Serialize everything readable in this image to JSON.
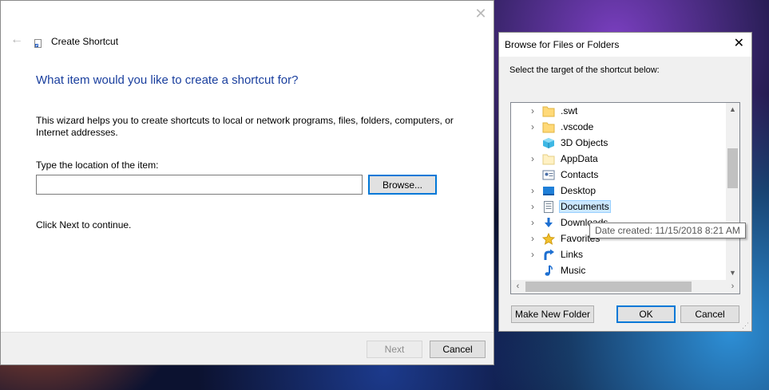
{
  "wizard": {
    "title": "Create Shortcut",
    "heading": "What item would you like to create a shortcut for?",
    "description": "This wizard helps you to create shortcuts to local or network programs, files, folders, computers, or Internet addresses.",
    "location_label": "Type the location of the item:",
    "location_value": "",
    "browse_label": "Browse...",
    "continue_text": "Click Next to continue.",
    "next_label": "Next",
    "cancel_label": "Cancel",
    "close_icon": "close-icon",
    "back_icon": "back-arrow-icon"
  },
  "browse": {
    "title": "Browse for Files or Folders",
    "prompt": "Select the target of the shortcut below:",
    "items": [
      {
        "label": ".swt",
        "icon": "folder-icon",
        "expandable": true
      },
      {
        "label": ".vscode",
        "icon": "folder-icon",
        "expandable": true
      },
      {
        "label": "3D Objects",
        "icon": "3d-objects-icon",
        "expandable": false
      },
      {
        "label": "AppData",
        "icon": "folder-icon",
        "expandable": true
      },
      {
        "label": "Contacts",
        "icon": "contacts-icon",
        "expandable": false
      },
      {
        "label": "Desktop",
        "icon": "desktop-icon",
        "expandable": true
      },
      {
        "label": "Documents",
        "icon": "documents-icon",
        "expandable": true,
        "selected": true
      },
      {
        "label": "Downloads",
        "icon": "downloads-icon",
        "expandable": true
      },
      {
        "label": "Favorites",
        "icon": "favorites-icon",
        "expandable": true
      },
      {
        "label": "Links",
        "icon": "links-icon",
        "expandable": true
      },
      {
        "label": "Music",
        "icon": "music-icon",
        "expandable": false
      }
    ],
    "tooltip": "Date created: 11/15/2018 8:21 AM",
    "make_folder_label": "Make New Folder",
    "ok_label": "OK",
    "cancel_label": "Cancel"
  },
  "colors": {
    "heading": "#1a3f9e",
    "accent": "#0078d7",
    "selection": "#cce8ff"
  }
}
